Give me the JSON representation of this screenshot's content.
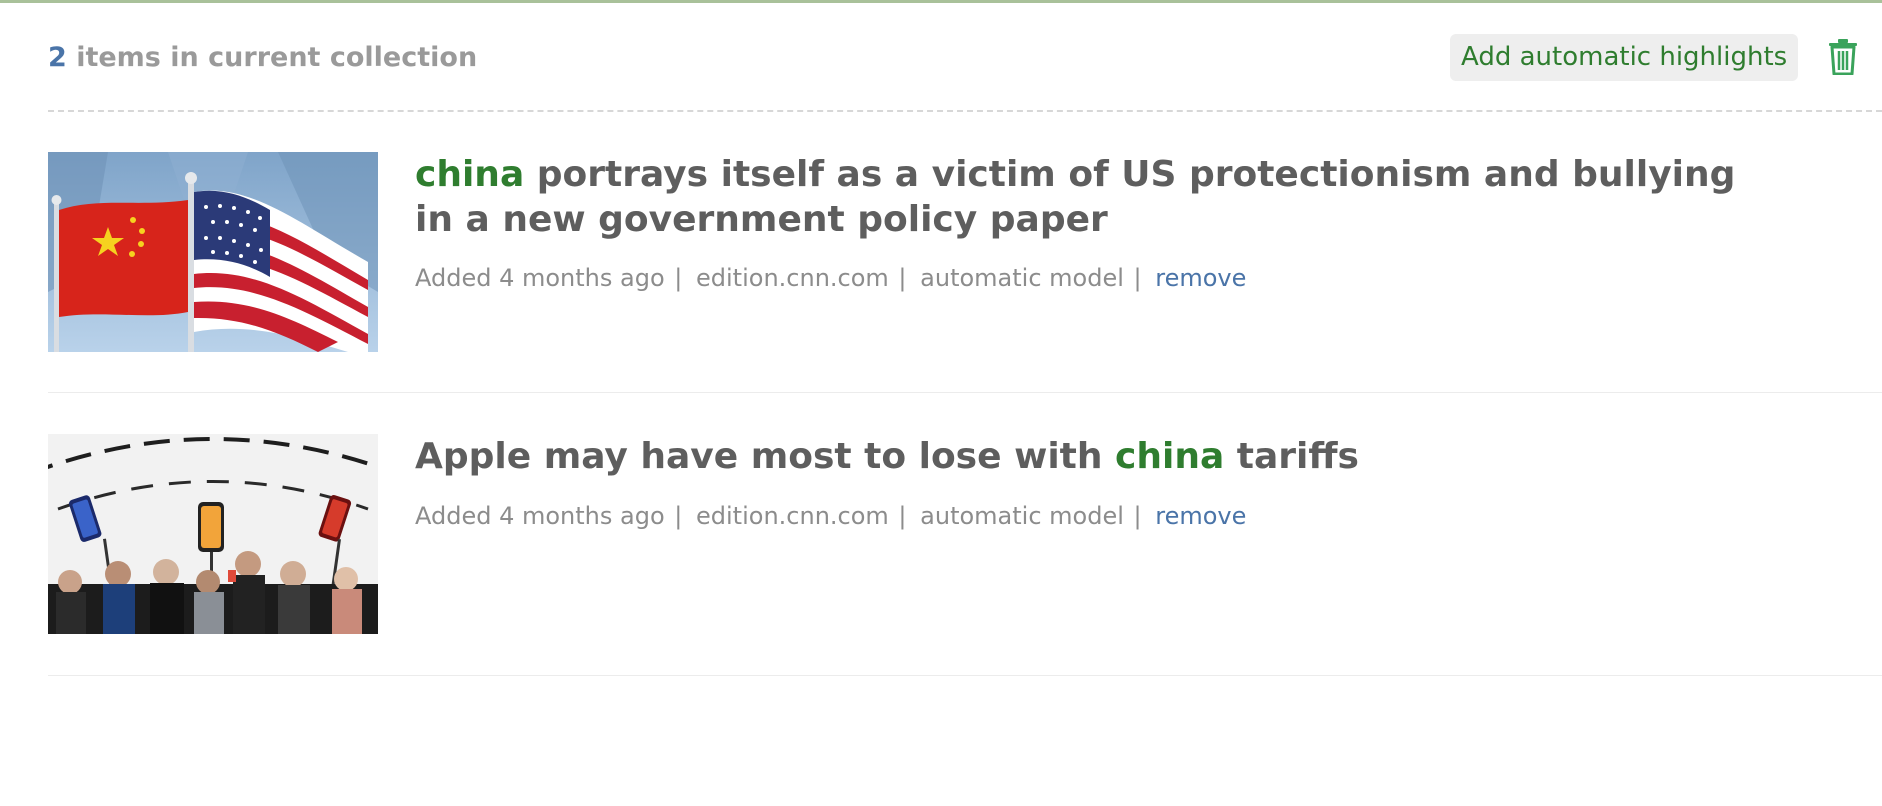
{
  "header": {
    "count": "2",
    "count_suffix": " items in current collection",
    "add_button_label": "Add automatic highlights",
    "trash_icon": "trash-icon"
  },
  "items": [
    {
      "title_highlight": "china",
      "title_rest": " portrays itself as a victim of US protectionism and bullying in a new government policy paper",
      "added": "Added 4 months ago",
      "source": "edition.cnn.com",
      "model": "automatic model",
      "remove_label": "remove",
      "thumbnail": "china-us-flags-image"
    },
    {
      "title_before": "Apple may have most to lose with ",
      "title_highlight": "china",
      "title_after": " tariffs",
      "added": "Added 4 months ago",
      "source": "edition.cnn.com",
      "model": "automatic model",
      "remove_label": "remove",
      "thumbnail": "iphone-event-crowd-image"
    }
  ],
  "colors": {
    "accent_green": "#2f7d2f",
    "link_blue": "#4a74a8",
    "text_gray": "#5e5e5e",
    "meta_gray": "#8c8c8c"
  }
}
